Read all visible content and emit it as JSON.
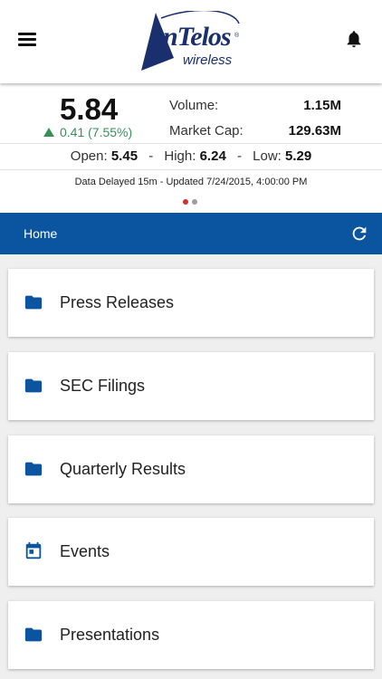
{
  "header": {
    "logo_name": "nTelos",
    "logo_sub": "wireless",
    "logo_reg": "®",
    "menu_icon": "hamburger-menu-icon",
    "bell_icon": "bell-icon"
  },
  "quote": {
    "price": "5.84",
    "change": "0.41 (7.55%)",
    "change_direction": "up",
    "volume_label": "Volume:",
    "volume_value": "1.15M",
    "market_cap_label": "Market Cap:",
    "market_cap_value": "129.63M",
    "open_label": "Open:",
    "open_value": "5.45",
    "high_label": "High:",
    "high_value": "6.24",
    "low_label": "Low:",
    "low_value": "5.29",
    "separator": "-",
    "delay_text": "Data Delayed 15m  -  Updated 7/24/2015, 4:00:00 PM",
    "pager": {
      "total": 2,
      "active": 0
    }
  },
  "nav": {
    "title": "Home",
    "refresh_icon": "refresh-icon"
  },
  "menu": [
    {
      "label": "Press Releases",
      "icon": "folder-icon"
    },
    {
      "label": "SEC Filings",
      "icon": "folder-icon"
    },
    {
      "label": "Quarterly Results",
      "icon": "folder-icon"
    },
    {
      "label": "Events",
      "icon": "calendar-icon"
    },
    {
      "label": "Presentations",
      "icon": "folder-icon"
    }
  ],
  "colors": {
    "brand_blue": "#0b55a0",
    "logo_navy": "#1a2f6e",
    "positive_green": "#3a8f5a",
    "pager_active": "#d32f2f",
    "pager_inactive": "#9e9e9e"
  }
}
